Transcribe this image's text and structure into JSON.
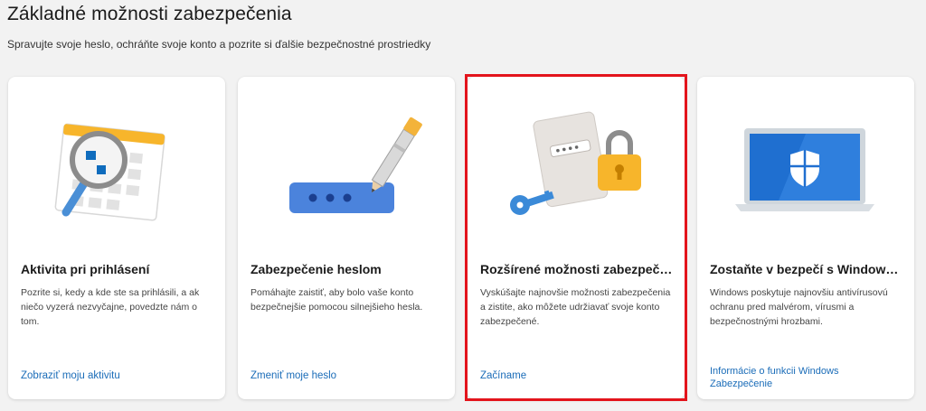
{
  "header": {
    "title": "Základné možnosti zabezpečenia",
    "subtitle": "Spravujte svoje heslo, ochráňte svoje konto a pozrite si ďalšie bezpečnostné prostriedky"
  },
  "cards": [
    {
      "title": "Aktivita pri prihlásení",
      "description": "Pozrite si, kedy a kde ste sa prihlásili, a ak niečo vyzerá nezvyčajne, povedzte nám o tom.",
      "link": "Zobraziť moju aktivitu",
      "icon": "calendar-magnifier-icon"
    },
    {
      "title": "Zabezpečenie heslom",
      "description": "Pomáhajte zaistiť, aby bolo vaše konto bezpečnejšie pomocou silnejšieho hesla.",
      "link": "Zmeniť moje heslo",
      "icon": "password-pen-icon"
    },
    {
      "title": "Rozšírené možnosti zabezpečeni…",
      "description": "Vyskúšajte najnovšie možnosti zabezpečenia a zistite, ako môžete udržiavať svoje konto zabezpečené.",
      "link": "Začíname",
      "icon": "key-lock-icon"
    },
    {
      "title": "Zostaňte v bezpečí s Windowsom",
      "description": "Windows poskytuje najnovšiu antivírusovú ochranu pred malvérom, vírusmi a bezpečnostnými hrozbami.",
      "link": "Informácie o funkcii Windows Zabezpečenie",
      "icon": "laptop-shield-icon"
    }
  ],
  "colors": {
    "link": "#1a6cb8",
    "highlight": "#e3141c",
    "accent_blue": "#0f6cbd",
    "accent_yellow": "#f7b52b"
  }
}
